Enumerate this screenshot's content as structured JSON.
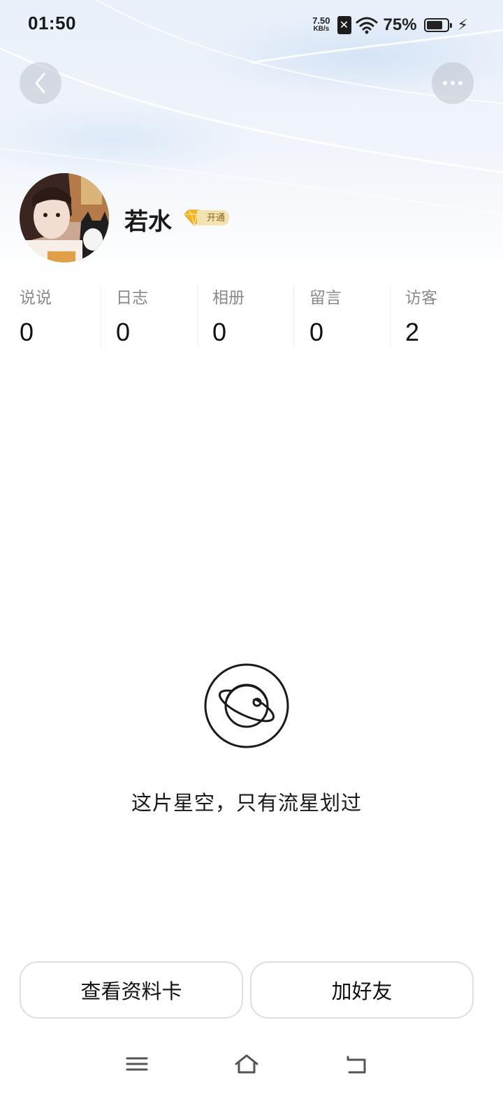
{
  "status_bar": {
    "time": "01:50",
    "net_speed_value": "7.50",
    "net_speed_unit": "KB/s",
    "sim_label": "✕",
    "battery_percent": "75%",
    "battery_level": 0.75,
    "icons": [
      "sim-icon",
      "wifi-icon",
      "battery-icon",
      "charging-bolt-icon"
    ]
  },
  "header": {
    "back_icon": "chevron-left-icon",
    "more_icon": "more-dots-icon"
  },
  "profile": {
    "name": "若水",
    "vip_label": "开通",
    "vip_icon": "diamond-icon"
  },
  "stats": [
    {
      "label": "说说",
      "value": "0"
    },
    {
      "label": "日志",
      "value": "0"
    },
    {
      "label": "相册",
      "value": "0"
    },
    {
      "label": "留言",
      "value": "0"
    },
    {
      "label": "访客",
      "value": "2"
    }
  ],
  "empty_state": {
    "icon": "planet-icon",
    "message": "这片星空，只有流星划过"
  },
  "actions": {
    "view_profile_card": "查看资料卡",
    "add_friend": "加好友"
  },
  "nav_bar": {
    "icons": [
      "menu-icon",
      "home-icon",
      "back-icon"
    ]
  }
}
